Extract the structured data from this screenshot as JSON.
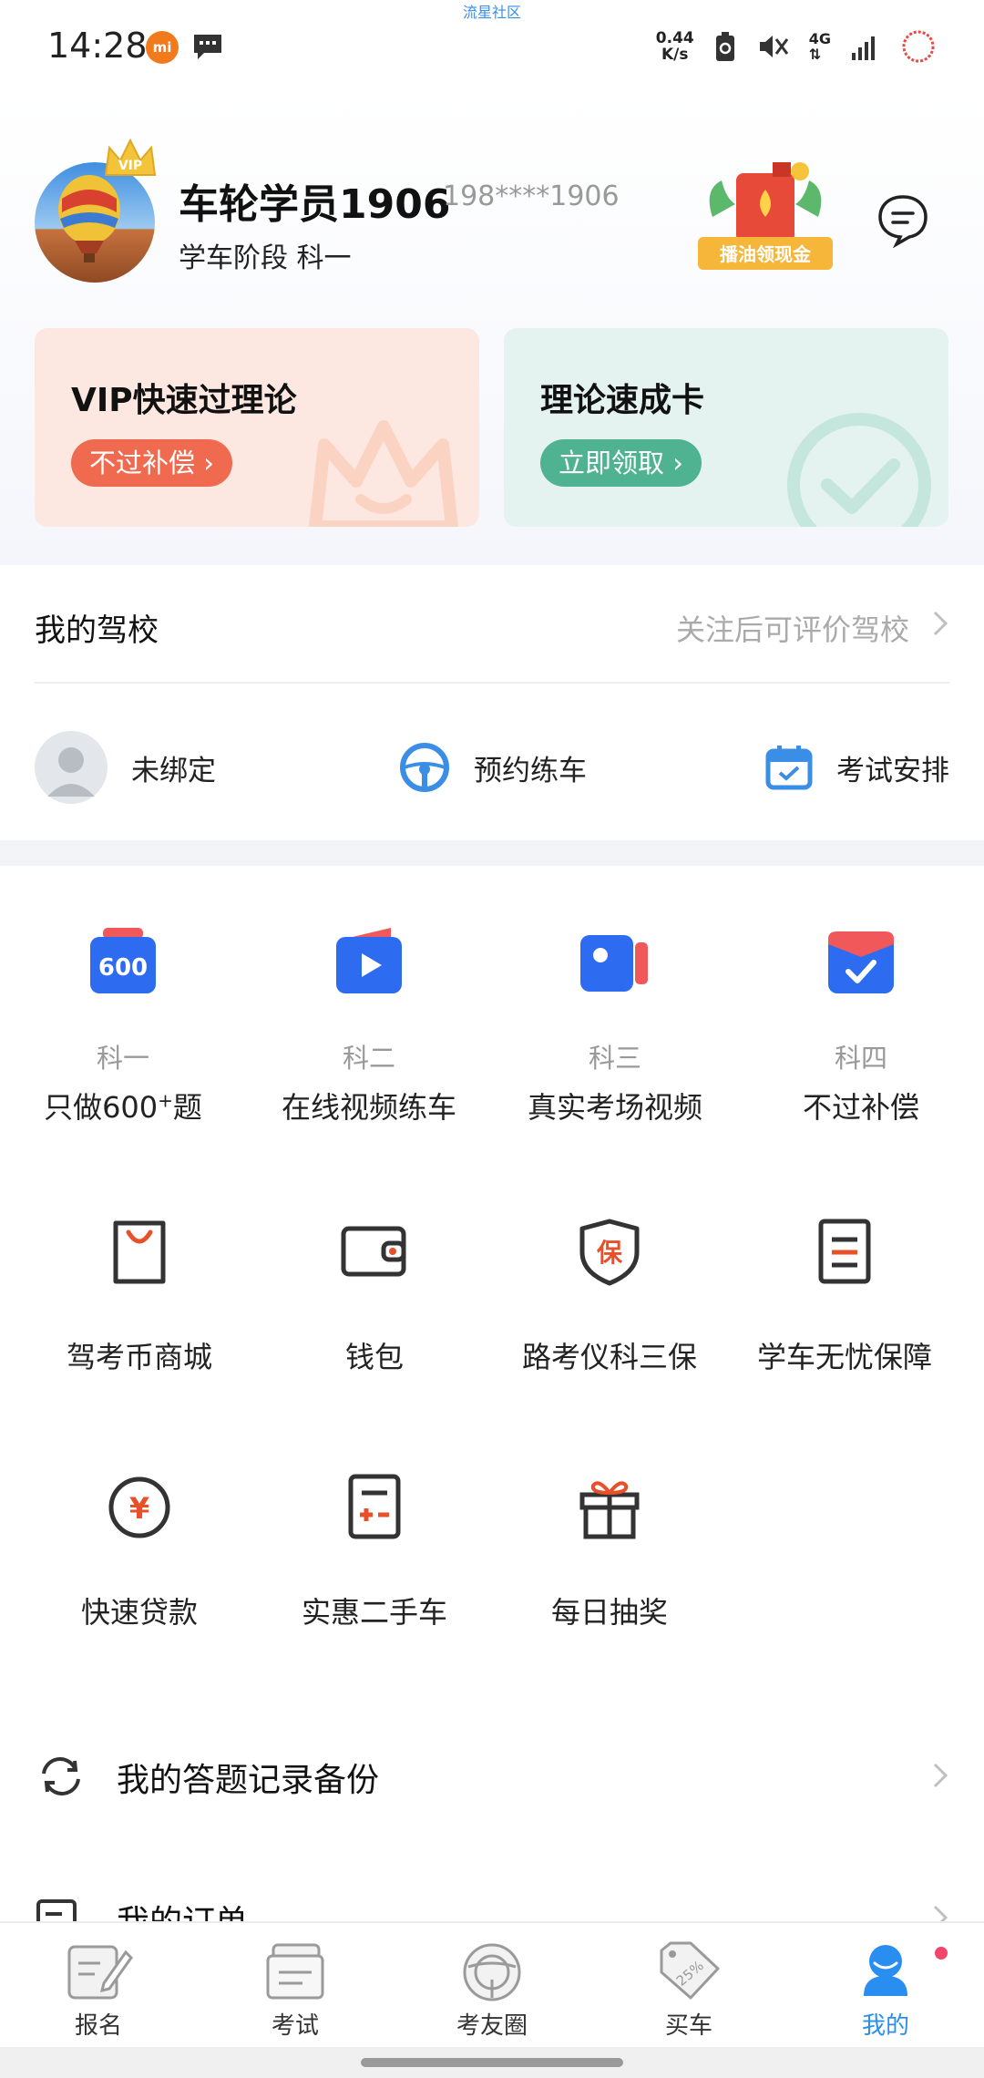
{
  "status_bar": {
    "time": "14:28",
    "top_text": "流星社区",
    "net_speed_value": "0.44",
    "net_speed_unit": "K/s",
    "network": "4G"
  },
  "profile": {
    "name": "车轮学员1906",
    "phone": "198****1906",
    "stage": "学车阶段 科一",
    "vip_badge": "VIP",
    "promo_text": "播油领现金"
  },
  "cards": [
    {
      "title": "VIP快速过理论",
      "button": "不过补偿"
    },
    {
      "title": "理论速成卡",
      "button": "立即领取"
    }
  ],
  "school": {
    "title": "我的驾校",
    "hint": "关注后可评价驾校"
  },
  "quick_actions": [
    {
      "label": "未绑定",
      "icon": "person-avatar-icon"
    },
    {
      "label": "预约练车",
      "icon": "steering-wheel-icon"
    },
    {
      "label": "考试安排",
      "icon": "calendar-icon"
    }
  ],
  "subjects": [
    {
      "sub": "科一",
      "label": "只做600",
      "label_sup": "+",
      "label_tail": "题",
      "icon_text": "600"
    },
    {
      "sub": "科二",
      "label": "在线视频练车"
    },
    {
      "sub": "科三",
      "label": "真实考场视频"
    },
    {
      "sub": "科四",
      "label": "不过补偿"
    }
  ],
  "services": [
    {
      "label": "驾考币商城",
      "icon": "shopping-bag-icon"
    },
    {
      "label": "钱包",
      "icon": "wallet-icon"
    },
    {
      "label": "路考仪科三保",
      "icon": "shield-icon",
      "icon_text": "保"
    },
    {
      "label": "学车无忧保障",
      "icon": "document-icon"
    },
    {
      "label": "快速贷款",
      "icon": "yuan-coin-icon",
      "icon_text": "¥"
    },
    {
      "label": "实惠二手车",
      "icon": "calculator-icon"
    },
    {
      "label": "每日抽奖",
      "icon": "gift-icon"
    }
  ],
  "list_rows": [
    {
      "label": "我的答题记录备份",
      "icon": "sync-icon"
    },
    {
      "label": "我的订单",
      "icon": "order-icon"
    }
  ],
  "tabbar": [
    {
      "label": "报名",
      "icon": "signup-icon"
    },
    {
      "label": "考试",
      "icon": "exam-icon"
    },
    {
      "label": "考友圈",
      "icon": "steering-wheel-icon"
    },
    {
      "label": "买车",
      "icon": "price-tag-icon",
      "icon_text": "25%"
    },
    {
      "label": "我的",
      "icon": "user-icon",
      "active": true
    }
  ],
  "colors": {
    "accent_blue": "#2a8ef0",
    "vip_red": "#f06a50",
    "theory_green": "#4fb392",
    "service_orange": "#e8502a"
  }
}
